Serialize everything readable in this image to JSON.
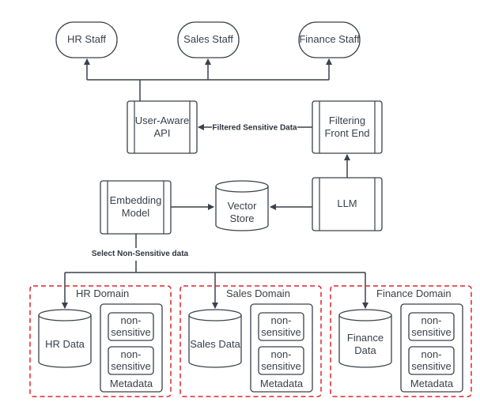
{
  "diagram": {
    "staff": [
      {
        "label": "HR Staff"
      },
      {
        "label": "Sales Staff"
      },
      {
        "label": "Finance Staff"
      }
    ],
    "user_api": {
      "line1": "User-Aware",
      "line2": "API"
    },
    "filtering": {
      "line1": "Filtering",
      "line2": "Front End"
    },
    "filtered_label": "Filtered Sensitive Data",
    "embedding": {
      "line1": "Embedding",
      "line2": "Model"
    },
    "vector_store": {
      "line1": "Vector",
      "line2": "Store"
    },
    "llm": {
      "label": "LLM"
    },
    "select_label": "Select Non-Sensitive data",
    "domains": [
      {
        "title": "HR Domain",
        "data_line1": "HR Data",
        "data_line2": ""
      },
      {
        "title": "Sales Domain",
        "data_line1": "Sales Data",
        "data_line2": ""
      },
      {
        "title": "Finance Domain",
        "data_line1": "Finance",
        "data_line2": "Data"
      }
    ],
    "meta_item_line1": "non-",
    "meta_item_line2": "sensitive",
    "metadata_label": "Metadata",
    "colors": {
      "stroke": "#3a414a",
      "domain_border": "#e0242b"
    }
  }
}
